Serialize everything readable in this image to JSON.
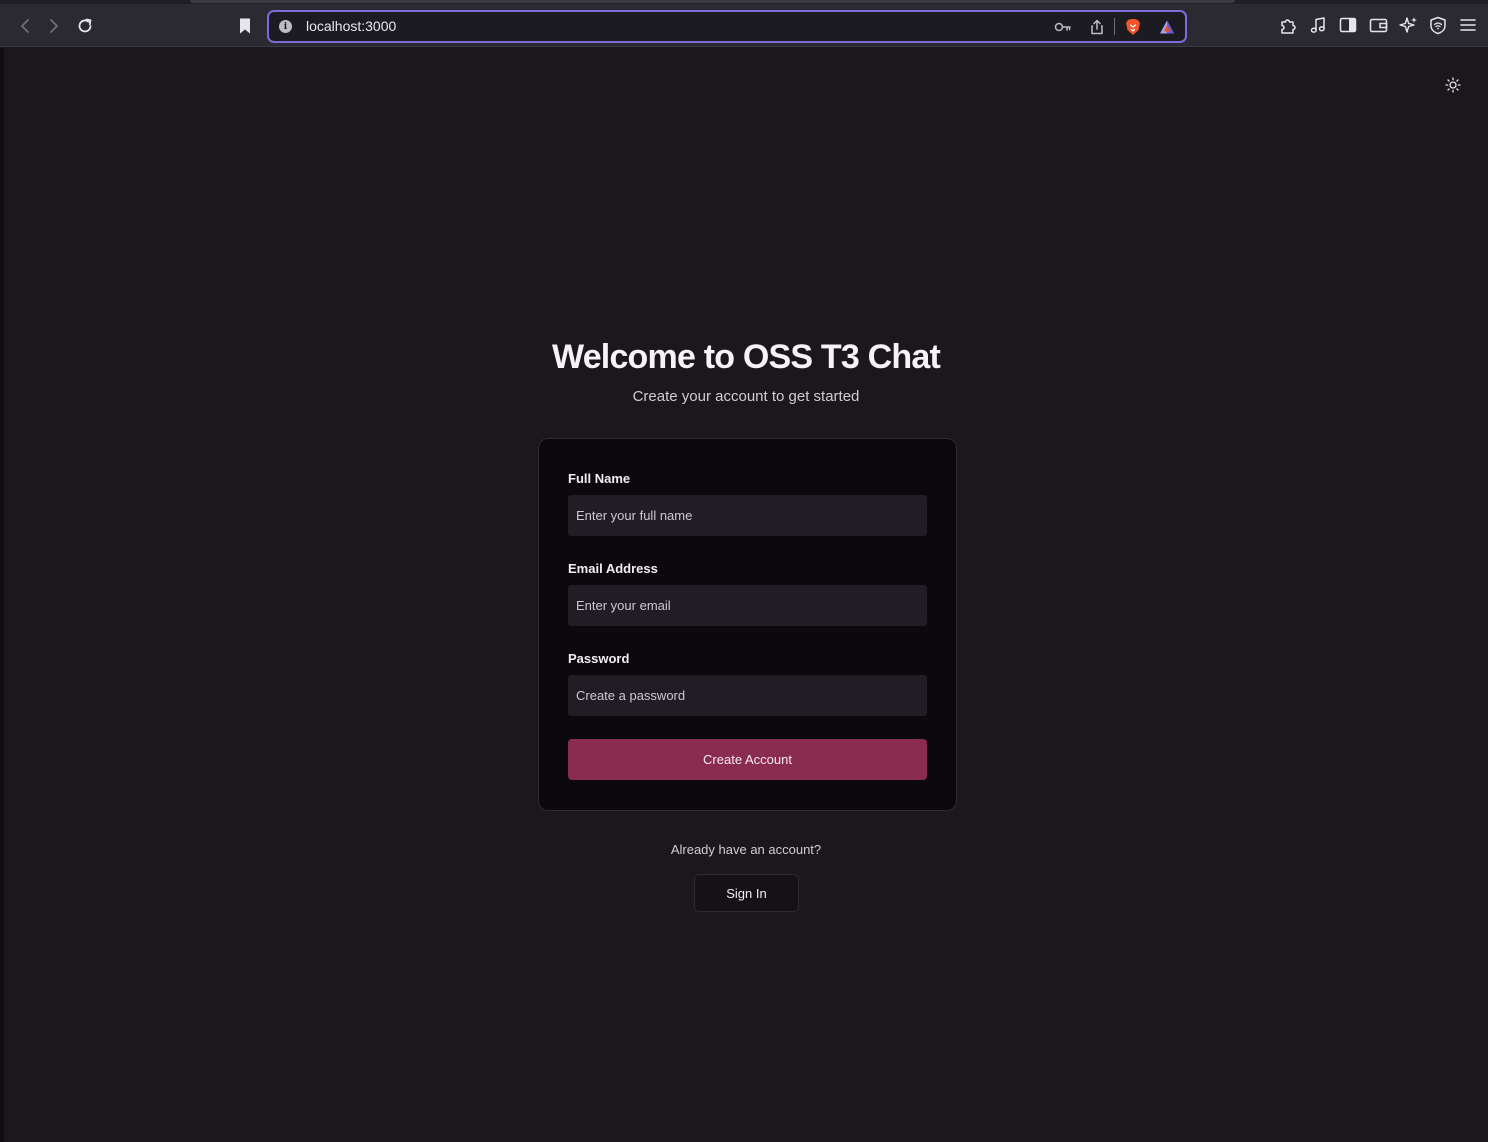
{
  "browser": {
    "url": "localhost:3000",
    "icons": {
      "back": "back-arrow-icon",
      "forward": "forward-arrow-icon",
      "reload": "reload-icon",
      "bookmark": "bookmark-icon",
      "site_info": "info-icon",
      "password": "key-icon",
      "share": "share-icon",
      "brave_shields": "brave-lion-icon",
      "brave_rewards": "brave-rewards-triangle-icon",
      "extensions": "puzzle-icon",
      "media": "music-note-icon",
      "sidebar": "sidebar-icon",
      "wallet": "wallet-icon",
      "leo": "sparkle-icon",
      "vpn": "vpn-shield-icon",
      "menu": "hamburger-menu-icon"
    }
  },
  "page": {
    "theme_toggle_icon": "sun-icon",
    "title": "Welcome to OSS T3 Chat",
    "subtitle": "Create your account to get started",
    "form": {
      "full_name": {
        "label": "Full Name",
        "placeholder": "Enter your full name",
        "value": ""
      },
      "email": {
        "label": "Email Address",
        "placeholder": "Enter your email",
        "value": ""
      },
      "password": {
        "label": "Password",
        "placeholder": "Create a password",
        "value": ""
      },
      "submit_label": "Create Account"
    },
    "signin_prompt": "Already have an account?",
    "signin_label": "Sign In"
  },
  "colors": {
    "background": "#1c171d",
    "card": "#0b090c",
    "input": "#221d24",
    "accent": "#8a2c4d",
    "url_focus_ring": "#7b6bd6"
  }
}
